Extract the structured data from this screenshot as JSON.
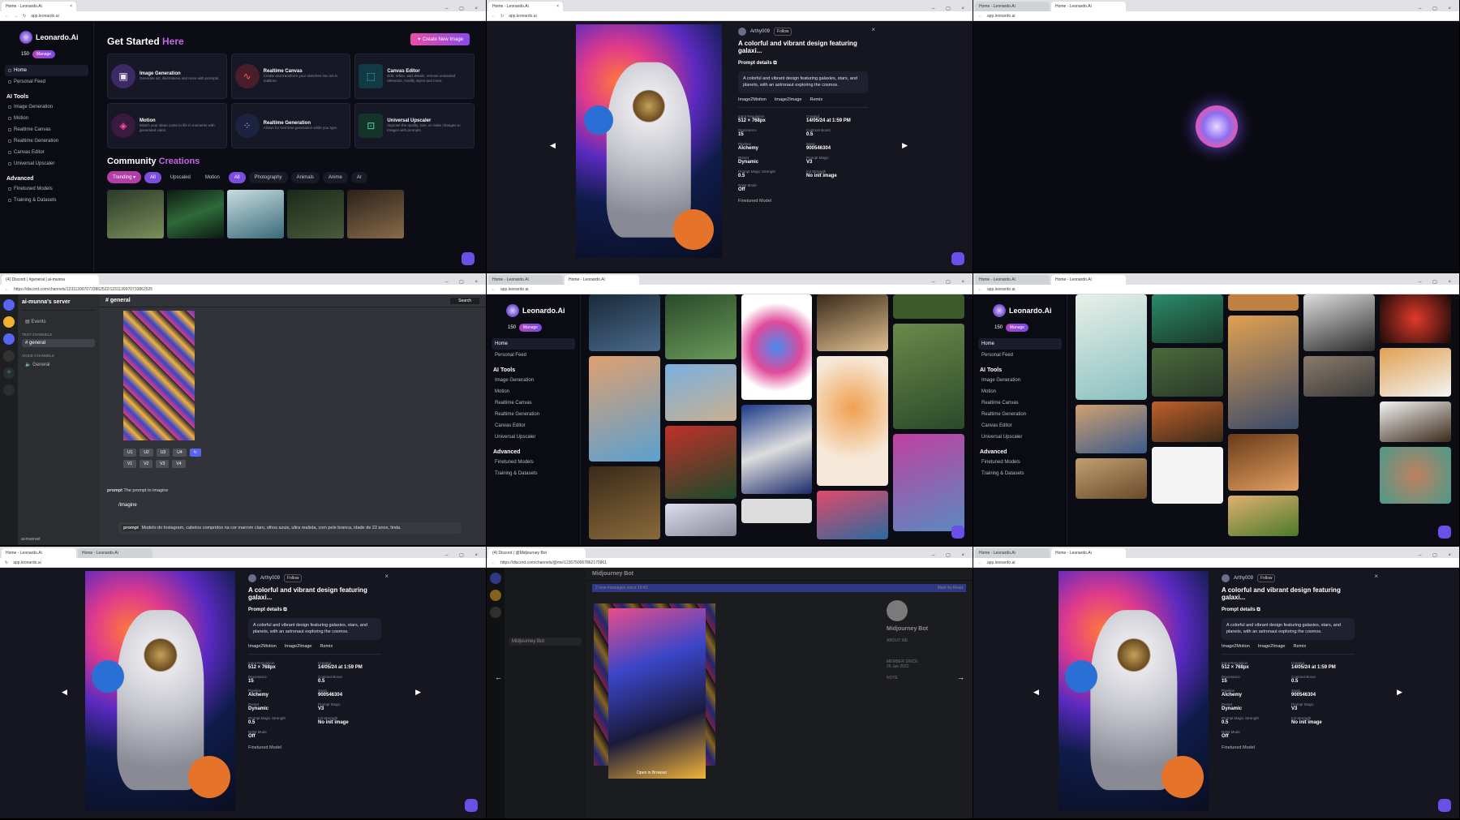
{
  "tabs": {
    "leonardo": "Home - Leonardo.Ai",
    "discord_general": "(4) Discord | #general | ai-munna",
    "discord_mj": "(4) Discord | @Midjourney Bot"
  },
  "urls": {
    "leonardo": "app.leonardo.ai",
    "discord_general": "https://discord.com/channels/1231139970733862522/1231139970733862525",
    "discord_mj": "https://discord.com/channels/@me/1230750067862170961"
  },
  "sidebar": {
    "brand": "Leonardo.Ai",
    "credits": "150",
    "manage": "Manage",
    "home": "Home",
    "personal_feed": "Personal Feed",
    "ai_tools_heading": "AI Tools",
    "image_generation": "Image Generation",
    "motion": "Motion",
    "realtime_canvas": "Realtime Canvas",
    "realtime_generation": "Realtime Generation",
    "canvas_editor": "Canvas Editor",
    "universal_upscaler": "Universal Upscaler",
    "advanced_heading": "Advanced",
    "finetuned_models": "Finetuned Models",
    "training_datasets": "Training & Datasets"
  },
  "home": {
    "title_plain": "Get Started",
    "title_accent": "Here",
    "create_button": "Create New Image",
    "community_plain": "Community",
    "community_accent": "Creations",
    "cards": [
      {
        "title": "Image Generation",
        "desc": "Generate art, illustrations and more with prompts."
      },
      {
        "title": "Realtime Canvas",
        "desc": "Create and transform your sketches into art in realtime."
      },
      {
        "title": "Canvas Editor",
        "desc": "Edit, refine, add details, remove unwanted elements, modify styles and more."
      },
      {
        "title": "Motion",
        "desc": "Watch your ideas come to life in moments with generated video."
      },
      {
        "title": "Realtime Generation",
        "desc": "Allows for real time generation while you type."
      },
      {
        "title": "Universal Upscaler",
        "desc": "Improve the quality, size, or make changes to images with prompts."
      }
    ],
    "chips": {
      "trending": "Trending",
      "all": "All",
      "upscaled": "Upscaled",
      "motion": "Motion",
      "all2": "All",
      "photography": "Photography",
      "animals": "Animals",
      "anime": "Anime",
      "more": "Ar"
    }
  },
  "modal": {
    "user": "Arthy009",
    "follow": "Follow",
    "title": "A colorful and vibrant design featuring galaxi...",
    "prompt_details": "Prompt details",
    "prompt": "A colorful and vibrant design featuring galaxies, stars, and planets, with an astronaut exploring the cosmos.",
    "image2motion": "Image2Motion",
    "image2image": "Image2Image",
    "remix": "Remix",
    "meta": [
      {
        "label": "Input Resolution",
        "value": "512 × 768px"
      },
      {
        "label": "Created",
        "value": "14/05/24 at 1:59 PM"
      },
      {
        "label": "Resonance",
        "value": "15"
      },
      {
        "label": "Contrast Boost",
        "value": "0.5"
      },
      {
        "label": "Pipeline",
        "value": "Alchemy"
      },
      {
        "label": "Seed",
        "value": "900546304"
      },
      {
        "label": "Preset",
        "value": "Dynamic"
      },
      {
        "label": "Prompt Magic",
        "value": "V3"
      },
      {
        "label": "Prompt Magic Strength",
        "value": "0.5"
      },
      {
        "label": "Init Strength",
        "value": "No init image"
      },
      {
        "label": "RAW Mode",
        "value": "Off"
      }
    ],
    "finetuned": "Finetuned Model"
  },
  "discord": {
    "server": "ai-munna's server",
    "events": "Events",
    "text_channels": "TEXT CHANNELS",
    "general": "general",
    "voice_channels": "VOICE CHANNELS",
    "voice_general": "General",
    "channel_header": "# general",
    "search": "Search",
    "u1": "U1",
    "u2": "U2",
    "u3": "U3",
    "u4": "U4",
    "v1": "V1",
    "v2": "V2",
    "v3": "V3",
    "v4": "V4",
    "prompt_hint_label": "prompt",
    "prompt_hint": "The prompt to imagine",
    "command": "/imagine",
    "input_label": "prompt",
    "input": "Modelo do Instagram, cabelos compridos na cor marrom claro, olhos azuis, ultra realista, com pele branca, idade de 22 anos, linda.",
    "username": "ai-munna#",
    "mj_name": "Midjourney Bot",
    "mj_about": "ABOUT ME",
    "mj_since": "MEMBER SINCE",
    "mj_since_value": "25 Jan 2022",
    "mj_note": "NOTE",
    "mj_new_messages": "2 new messages since 16:42",
    "mj_mark_read": "Mark As Read",
    "mj_open": "Open in Browser"
  }
}
